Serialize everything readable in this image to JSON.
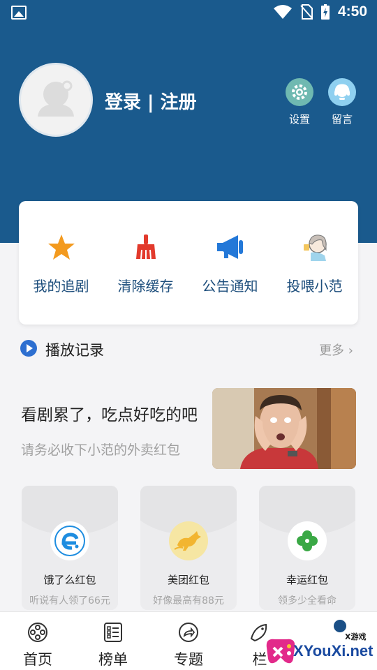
{
  "status_bar": {
    "time": "4:50",
    "icons": [
      "image-icon",
      "wifi-icon",
      "no-sim-icon",
      "battery-charging-icon"
    ]
  },
  "profile": {
    "login_label": "登录 | 注册",
    "avatar_icon": "user-avatar-icon"
  },
  "top_actions": [
    {
      "label": "设置",
      "icon": "gear-icon",
      "color": "#6fb9b1"
    },
    {
      "label": "留言",
      "icon": "headset-icon",
      "color": "#8fd0f0"
    }
  ],
  "quick_actions": [
    {
      "label": "我的追剧",
      "icon": "star-icon",
      "color": "#f39a1e"
    },
    {
      "label": "清除缓存",
      "icon": "broom-icon",
      "color": "#e23a2c"
    },
    {
      "label": "公告通知",
      "icon": "megaphone-icon",
      "color": "#2378d8"
    },
    {
      "label": "投喂小范",
      "icon": "girl-drinking-icon",
      "color": "#c89a6a"
    }
  ],
  "history": {
    "title": "播放记录",
    "more": "更多",
    "icon": "play-circle-icon",
    "accent": "#2d6fd0"
  },
  "promo": {
    "title": "看剧累了，吃点好吃的吧",
    "subtitle": "请务必收下小范的外卖红包",
    "image": "surprised-man-photo"
  },
  "coupons": [
    {
      "name": "饿了么红包",
      "desc": "听说有人领了66元",
      "icon": "eleme-logo-icon",
      "color": "#1e8de0"
    },
    {
      "name": "美团红包",
      "desc": "好像最高有88元",
      "icon": "kangaroo-logo-icon",
      "color": "#f2c640"
    },
    {
      "name": "幸运红包",
      "desc": "领多少全看命",
      "icon": "clover-icon",
      "color": "#3aa845"
    }
  ],
  "bottom_nav": [
    {
      "label": "首页",
      "icon": "film-reel-icon"
    },
    {
      "label": "榜单",
      "icon": "list-icon"
    },
    {
      "label": "专题",
      "icon": "share-arrow-icon"
    },
    {
      "label": "栏",
      "icon": "fish-icon"
    }
  ],
  "watermark": {
    "brand": "XYouXi.net",
    "small": "X游戏"
  },
  "colors": {
    "header_bg": "#1a5a8d",
    "label_blue": "#1d4e7c",
    "page_bg": "#f4f4f6"
  }
}
